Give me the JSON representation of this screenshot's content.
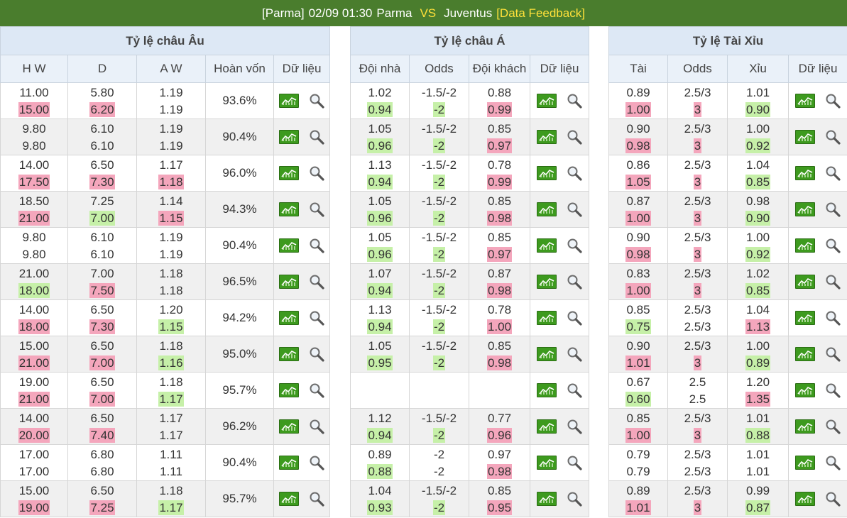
{
  "header": {
    "league": "[Parma]",
    "datetime": "02/09 01:30",
    "home": "Parma",
    "vs": "VS",
    "away": "Juventus",
    "feedback": "[Data Feedback]"
  },
  "europe": {
    "title": "Tỷ lệ châu Âu",
    "columns": [
      "H W",
      "D",
      "A W",
      "Hoàn vốn",
      "Dữ liệu"
    ],
    "rows": [
      {
        "hw": [
          "11.00",
          "15.00"
        ],
        "d": [
          "5.80",
          "6.20"
        ],
        "aw": [
          "1.19",
          "1.19"
        ],
        "ret": "93.6%",
        "hwc": "up",
        "dc": "up",
        "awc": ""
      },
      {
        "hw": [
          "9.80",
          "9.80"
        ],
        "d": [
          "6.10",
          "6.10"
        ],
        "aw": [
          "1.19",
          "1.19"
        ],
        "ret": "90.4%",
        "hwc": "",
        "dc": "",
        "awc": ""
      },
      {
        "hw": [
          "14.00",
          "17.50"
        ],
        "d": [
          "6.50",
          "7.30"
        ],
        "aw": [
          "1.17",
          "1.18"
        ],
        "ret": "96.0%",
        "hwc": "up",
        "dc": "up",
        "awc": "up"
      },
      {
        "hw": [
          "18.50",
          "21.00"
        ],
        "d": [
          "7.25",
          "7.00"
        ],
        "aw": [
          "1.14",
          "1.15"
        ],
        "ret": "94.3%",
        "hwc": "up",
        "dc": "down",
        "awc": "up"
      },
      {
        "hw": [
          "9.80",
          "9.80"
        ],
        "d": [
          "6.10",
          "6.10"
        ],
        "aw": [
          "1.19",
          "1.19"
        ],
        "ret": "90.4%",
        "hwc": "",
        "dc": "",
        "awc": ""
      },
      {
        "hw": [
          "21.00",
          "18.00"
        ],
        "d": [
          "7.00",
          "7.50"
        ],
        "aw": [
          "1.18",
          "1.18"
        ],
        "ret": "96.5%",
        "hwc": "down",
        "dc": "up",
        "awc": ""
      },
      {
        "hw": [
          "14.00",
          "18.00"
        ],
        "d": [
          "6.50",
          "7.30"
        ],
        "aw": [
          "1.20",
          "1.15"
        ],
        "ret": "94.2%",
        "hwc": "up",
        "dc": "up",
        "awc": "down"
      },
      {
        "hw": [
          "15.00",
          "21.00"
        ],
        "d": [
          "6.50",
          "7.00"
        ],
        "aw": [
          "1.18",
          "1.16"
        ],
        "ret": "95.0%",
        "hwc": "up",
        "dc": "up",
        "awc": "down"
      },
      {
        "hw": [
          "19.00",
          "21.00"
        ],
        "d": [
          "6.50",
          "7.00"
        ],
        "aw": [
          "1.18",
          "1.17"
        ],
        "ret": "95.7%",
        "hwc": "up",
        "dc": "up",
        "awc": "down"
      },
      {
        "hw": [
          "14.00",
          "20.00"
        ],
        "d": [
          "6.50",
          "7.40"
        ],
        "aw": [
          "1.17",
          "1.17"
        ],
        "ret": "96.2%",
        "hwc": "up",
        "dc": "up",
        "awc": ""
      },
      {
        "hw": [
          "17.00",
          "17.00"
        ],
        "d": [
          "6.80",
          "6.80"
        ],
        "aw": [
          "1.11",
          "1.11"
        ],
        "ret": "90.4%",
        "hwc": "",
        "dc": "",
        "awc": ""
      },
      {
        "hw": [
          "15.00",
          "19.00"
        ],
        "d": [
          "6.50",
          "7.25"
        ],
        "aw": [
          "1.18",
          "1.17"
        ],
        "ret": "95.7%",
        "hwc": "up",
        "dc": "up",
        "awc": "down"
      }
    ]
  },
  "asian": {
    "title": "Tỷ lệ châu Á",
    "columns": [
      "Đội nhà",
      "Odds",
      "Đội khách",
      "Dữ liệu"
    ],
    "rows": [
      {
        "h": [
          "1.02",
          "0.94"
        ],
        "o": [
          "-1.5/-2",
          "-2"
        ],
        "a": [
          "0.88",
          "0.99"
        ],
        "hc": "down",
        "oc": "down",
        "ac": "up"
      },
      {
        "h": [
          "1.05",
          "0.96"
        ],
        "o": [
          "-1.5/-2",
          "-2"
        ],
        "a": [
          "0.85",
          "0.97"
        ],
        "hc": "down",
        "oc": "down",
        "ac": "up"
      },
      {
        "h": [
          "1.13",
          "0.94"
        ],
        "o": [
          "-1.5/-2",
          "-2"
        ],
        "a": [
          "0.78",
          "0.99"
        ],
        "hc": "down",
        "oc": "down",
        "ac": "up"
      },
      {
        "h": [
          "1.05",
          "0.96"
        ],
        "o": [
          "-1.5/-2",
          "-2"
        ],
        "a": [
          "0.85",
          "0.98"
        ],
        "hc": "down",
        "oc": "down",
        "ac": "up"
      },
      {
        "h": [
          "1.05",
          "0.96"
        ],
        "o": [
          "-1.5/-2",
          "-2"
        ],
        "a": [
          "0.85",
          "0.97"
        ],
        "hc": "down",
        "oc": "down",
        "ac": "up"
      },
      {
        "h": [
          "1.07",
          "0.94"
        ],
        "o": [
          "-1.5/-2",
          "-2"
        ],
        "a": [
          "0.87",
          "0.98"
        ],
        "hc": "down",
        "oc": "down",
        "ac": "up"
      },
      {
        "h": [
          "1.13",
          "0.94"
        ],
        "o": [
          "-1.5/-2",
          "-2"
        ],
        "a": [
          "0.78",
          "1.00"
        ],
        "hc": "down",
        "oc": "down",
        "ac": "up"
      },
      {
        "h": [
          "1.05",
          "0.95"
        ],
        "o": [
          "-1.5/-2",
          "-2"
        ],
        "a": [
          "0.85",
          "0.98"
        ],
        "hc": "down",
        "oc": "down",
        "ac": "up"
      },
      {
        "h": [
          "",
          ""
        ],
        "o": [
          "",
          ""
        ],
        "a": [
          "",
          ""
        ],
        "hc": "",
        "oc": "",
        "ac": ""
      },
      {
        "h": [
          "1.12",
          "0.94"
        ],
        "o": [
          "-1.5/-2",
          "-2"
        ],
        "a": [
          "0.77",
          "0.96"
        ],
        "hc": "down",
        "oc": "down",
        "ac": "up"
      },
      {
        "h": [
          "0.89",
          "0.88"
        ],
        "o": [
          "-2",
          "-2"
        ],
        "a": [
          "0.97",
          "0.98"
        ],
        "hc": "down",
        "oc": "",
        "ac": "up"
      },
      {
        "h": [
          "1.04",
          "0.93"
        ],
        "o": [
          "-1.5/-2",
          "-2"
        ],
        "a": [
          "0.85",
          "0.95"
        ],
        "hc": "down",
        "oc": "down",
        "ac": "up"
      }
    ]
  },
  "overunder": {
    "title": "Tỷ lệ Tài Xỉu",
    "columns": [
      "Tài",
      "Odds",
      "Xỉu",
      "Dữ liệu"
    ],
    "rows": [
      {
        "t": [
          "0.89",
          "1.00"
        ],
        "o": [
          "2.5/3",
          "3"
        ],
        "x": [
          "1.01",
          "0.90"
        ],
        "tc": "up",
        "oc": "up",
        "xc": "down"
      },
      {
        "t": [
          "0.90",
          "0.98"
        ],
        "o": [
          "2.5/3",
          "3"
        ],
        "x": [
          "1.00",
          "0.92"
        ],
        "tc": "up",
        "oc": "up",
        "xc": "down"
      },
      {
        "t": [
          "0.86",
          "1.05"
        ],
        "o": [
          "2.5/3",
          "3"
        ],
        "x": [
          "1.04",
          "0.85"
        ],
        "tc": "up",
        "oc": "up",
        "xc": "down"
      },
      {
        "t": [
          "0.87",
          "1.00"
        ],
        "o": [
          "2.5/3",
          "3"
        ],
        "x": [
          "0.98",
          "0.90"
        ],
        "tc": "up",
        "oc": "up",
        "xc": "down"
      },
      {
        "t": [
          "0.90",
          "0.98"
        ],
        "o": [
          "2.5/3",
          "3"
        ],
        "x": [
          "1.00",
          "0.92"
        ],
        "tc": "up",
        "oc": "up",
        "xc": "down"
      },
      {
        "t": [
          "0.83",
          "1.00"
        ],
        "o": [
          "2.5/3",
          "3"
        ],
        "x": [
          "1.02",
          "0.85"
        ],
        "tc": "up",
        "oc": "up",
        "xc": "down"
      },
      {
        "t": [
          "0.85",
          "0.75"
        ],
        "o": [
          "2.5/3",
          "2.5/3"
        ],
        "x": [
          "1.04",
          "1.13"
        ],
        "tc": "down",
        "oc": "",
        "xc": "up"
      },
      {
        "t": [
          "0.90",
          "1.01"
        ],
        "o": [
          "2.5/3",
          "3"
        ],
        "x": [
          "1.00",
          "0.89"
        ],
        "tc": "up",
        "oc": "up",
        "xc": "down"
      },
      {
        "t": [
          "0.67",
          "0.60"
        ],
        "o": [
          "2.5",
          "2.5"
        ],
        "x": [
          "1.20",
          "1.35"
        ],
        "tc": "down",
        "oc": "",
        "xc": "up"
      },
      {
        "t": [
          "0.85",
          "1.00"
        ],
        "o": [
          "2.5/3",
          "3"
        ],
        "x": [
          "1.01",
          "0.88"
        ],
        "tc": "up",
        "oc": "up",
        "xc": "down"
      },
      {
        "t": [
          "0.79",
          "0.79"
        ],
        "o": [
          "2.5/3",
          "2.5/3"
        ],
        "x": [
          "1.01",
          "1.01"
        ],
        "tc": "",
        "oc": "",
        "xc": ""
      },
      {
        "t": [
          "0.89",
          "1.01"
        ],
        "o": [
          "2.5/3",
          "3"
        ],
        "x": [
          "0.99",
          "0.87"
        ],
        "tc": "up",
        "oc": "up",
        "xc": "down"
      }
    ]
  },
  "icons": {
    "chart": "chart-icon",
    "search": "magnifier-icon"
  },
  "colors": {
    "header_bg": "#4a7d2d",
    "accent": "#ffe13a",
    "rise": "#f4a6bc",
    "fall": "#c6f0a8",
    "row_alt": "#f0f0f0"
  }
}
